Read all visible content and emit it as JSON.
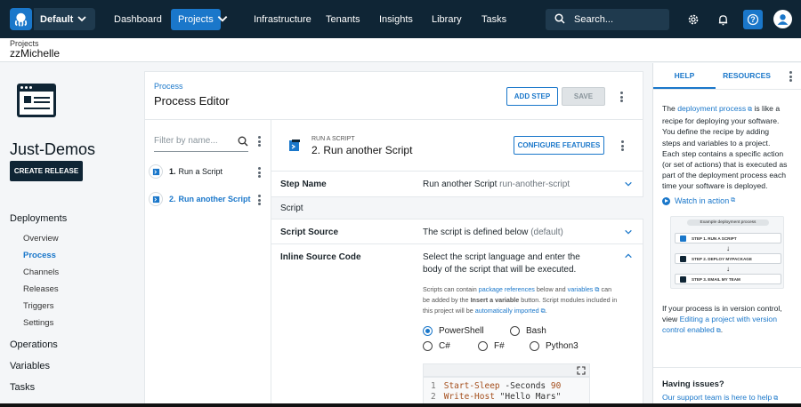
{
  "topnav": {
    "space": "Default",
    "items": [
      "Dashboard",
      "Projects",
      "Infrastructure",
      "Tenants",
      "Insights",
      "Library",
      "Tasks"
    ],
    "active": "Projects",
    "search_placeholder": "Search...",
    "help_label": "?"
  },
  "header": {
    "breadcrumb": "Projects",
    "project_name": "zzMichelle"
  },
  "sidebar": {
    "project_title": "Just-Demos",
    "create_release": "CREATE RELEASE",
    "deployments": "Deployments",
    "deployment_items": [
      "Overview",
      "Process",
      "Channels",
      "Releases",
      "Triggers",
      "Settings"
    ],
    "active_item": "Process",
    "operations": "Operations",
    "variables": "Variables",
    "tasks": "Tasks"
  },
  "editor": {
    "breadcrumb": "Process",
    "title": "Process Editor",
    "add_step": "ADD STEP",
    "save": "SAVE",
    "filter_placeholder": "Filter by name...",
    "steps": [
      {
        "num": "1.",
        "label": "Run a Script"
      },
      {
        "num": "2.",
        "label": "Run another Script"
      }
    ]
  },
  "detail": {
    "tag": "RUN A SCRIPT",
    "title": "2. Run another Script",
    "configure": "CONFIGURE FEATURES",
    "step_name_label": "Step Name",
    "step_name_value": "Run another Script",
    "step_name_slug": "run-another-script",
    "section": "Script",
    "script_source_label": "Script Source",
    "script_source_value": "The script is defined below",
    "script_source_suffix": "(default)",
    "inline_label": "Inline Source Code",
    "inline_desc": "Select the script language and enter the body of the script that will be executed.",
    "help_part1": "Scripts can contain ",
    "help_link1": "package references",
    "help_part2": " below and ",
    "help_link2": "variables",
    "help_part3": " can be added by the ",
    "help_bold": "Insert a variable",
    "help_part4": " button. Script modules included in this project will be ",
    "help_link3": "automatically imported",
    "help_part5": ".",
    "languages": [
      "PowerShell",
      "Bash",
      "C#",
      "F#",
      "Python3"
    ],
    "selected_language": "PowerShell",
    "code": [
      {
        "ln": "1",
        "cmd": "Start-Sleep",
        "arg": " -Seconds ",
        "val": "90"
      },
      {
        "ln": "2",
        "cmd": "Write-Host",
        "arg": " ",
        "val": "\"Hello Mars\""
      }
    ]
  },
  "help": {
    "tab_help": "HELP",
    "tab_resources": "RESOURCES",
    "p1_pre": "The ",
    "p1_link": "deployment process",
    "p1_post": " is like a recipe for deploying your software. You define the recipe by adding steps and variables to a project. Each step contains a specific action (or set of actions) that is executed as part of the deployment process each time your software is deployed.",
    "watch": "Watch in action",
    "diagram_title": "Example deployment process",
    "diagram_steps": [
      "STEP 1. RUN A SCRIPT",
      "STEP 2. DEPLOY MYPACKAGE",
      "STEP 3. EMAIL MY TEAM"
    ],
    "p2_pre": "If your process is in version control, view ",
    "p2_link": "Editing a project with version control enabled",
    "p2_post": ".",
    "issues": "Having issues?",
    "support": "Our support team is here to help"
  }
}
